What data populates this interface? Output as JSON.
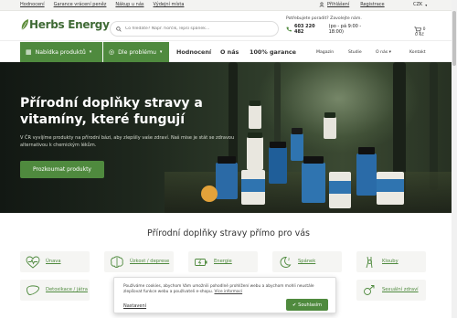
{
  "topbar": {
    "links": [
      "Hodnocení",
      "Garance vrácení peněz",
      "Nákup u nás",
      "Výdejní místa"
    ],
    "login": "Přihlášení",
    "register": "Registrace",
    "currency": "CZK"
  },
  "header": {
    "logo": "Herbs Energy",
    "search_placeholder": "Co hledáte? Např. hořčík, lepší spánek...",
    "help_text": "Potřebujete poradit? Zavolejte nám.",
    "phone": "603 220 482",
    "hours": "(po - pá 9:00 - 18:00)",
    "cart_count": "0",
    "cart_price": "0 Kč"
  },
  "nav": {
    "products": "Nabídka produktů",
    "problems": "Dle problému",
    "reviews": "Hodnocení",
    "about": "O nás",
    "guarantee": "100% garance",
    "small_links": [
      "Magazín",
      "Studie",
      "O nás",
      "Kontakt"
    ]
  },
  "hero": {
    "title": "Přírodní doplňky stravy a vitamíny, které fungují",
    "text": "V ČR vyvíjíme produkty na přírodní bázi, aby zlepšily vaše zdraví. Naš mise je stát se zdravou alternativou k chemickým lékům.",
    "button": "Prozkoumat produkty"
  },
  "problems": {
    "title": "Přírodní doplňky stravy přímo pro vás",
    "items": [
      "Únava",
      "Úzkost / deprese",
      "Energie",
      "Spánek",
      "Klouby",
      "Detoxikace / játra",
      "",
      "",
      "",
      "Sexuální zdraví"
    ]
  },
  "cookie": {
    "text": "Používáme cookies, abychom Vám umožnili pohodlné prohlížení webu a abychom mohli neustále zlepšovat funkce webu a používateli e-shopu.",
    "more": "Více informací",
    "settings": "Nastavení",
    "accept": "Souhlasím"
  },
  "colors": {
    "brand_green": "#4f8a3e",
    "dark_hero": "#1e271d"
  }
}
